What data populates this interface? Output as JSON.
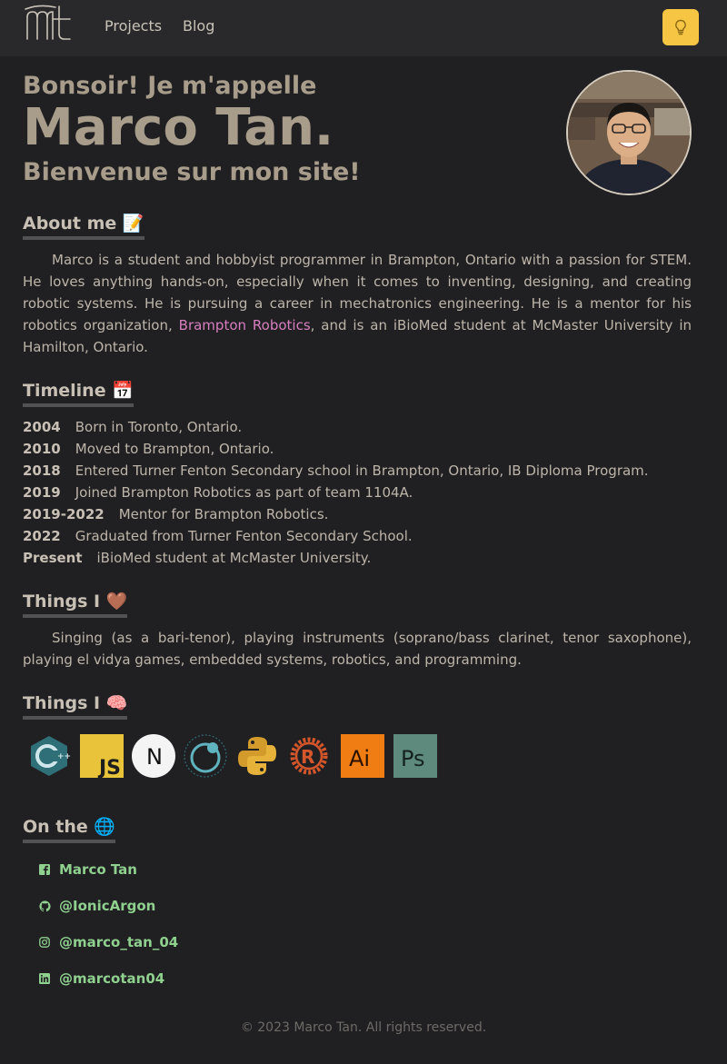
{
  "nav": {
    "logo_alt": "mt",
    "links": [
      "Projects",
      "Blog"
    ],
    "theme_toggle_icon": "lightbulb-icon",
    "accent_color": "#f6c544"
  },
  "hero": {
    "greeting": "Bonsoir! Je m'appelle",
    "name": "Marco Tan.",
    "welcome": "Bienvenue sur mon site!"
  },
  "about": {
    "title": "About me 📝",
    "text_before_link": "Marco is a student and hobbyist programmer in Brampton, Ontario with a passion for STEM. He loves anything hands-on, especially when it comes to inventing, designing, and creating robotic systems. He is pursuing a career in mechatronics engineering. He is a mentor for his robotics organization, ",
    "link_text": "Brampton Robotics",
    "text_after_link": ", and is an iBioMed student at McMaster University in Hamilton, Ontario."
  },
  "timeline": {
    "title": "Timeline 📅",
    "entries": [
      {
        "year": "2004",
        "event": "Born in Toronto, Ontario."
      },
      {
        "year": "2010",
        "event": "Moved to Brampton, Ontario."
      },
      {
        "year": "2018",
        "event": "Entered Turner Fenton Secondary school in Brampton, Ontario, IB Diploma Program."
      },
      {
        "year": "2019",
        "event": "Joined Brampton Robotics as part of team 1104A."
      },
      {
        "year": "2019-2022",
        "event": "Mentor for Brampton Robotics."
      },
      {
        "year": "2022",
        "event": "Graduated from Turner Fenton Secondary School."
      },
      {
        "year": "Present",
        "event": "iBioMed student at McMaster University."
      }
    ]
  },
  "likes": {
    "title": "Things I 🤎",
    "text": "Singing (as a bari-tenor), playing instruments (soprano/bass clarinet, tenor saxophone), playing el vidya games, embedded systems, robotics, and programming."
  },
  "skills": {
    "title": "Things I 🧠",
    "icons": [
      "cplusplus-icon",
      "javascript-icon",
      "nextjs-icon",
      "electron-icon",
      "python-icon",
      "rust-icon",
      "illustrator-icon",
      "photoshop-icon"
    ],
    "js_label": "JS",
    "ai_label": "Ai",
    "ps_label": "Ps",
    "next_label": "N"
  },
  "social": {
    "title": "On the 🌐",
    "links": [
      {
        "icon": "facebook-icon",
        "label": "Marco Tan"
      },
      {
        "icon": "github-icon",
        "label": "@IonicArgon"
      },
      {
        "icon": "instagram-icon",
        "label": "@marco_tan_04"
      },
      {
        "icon": "linkedin-icon",
        "label": "@marcotan04"
      }
    ],
    "link_color": "#8fd08f"
  },
  "footer": {
    "text": "© 2023 Marco Tan. All rights reserved."
  }
}
